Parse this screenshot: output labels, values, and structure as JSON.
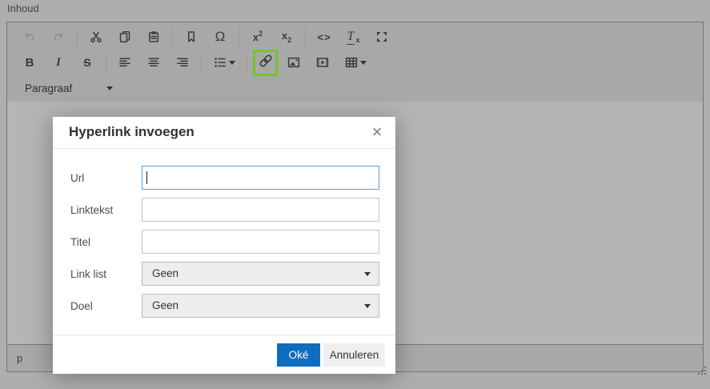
{
  "page": {
    "content_label": "Inhoud"
  },
  "toolbar": {
    "glyphs": {
      "bold": "B",
      "italic": "I",
      "strikethrough": "S",
      "charmap": "Ω",
      "sup_base": "x",
      "sup_mark": "2",
      "sub_base": "x",
      "sub_mark": "2",
      "code": "<>",
      "removeformat_base": "T",
      "removeformat_mark": "x"
    },
    "format_select": {
      "value": "Paragraaf"
    },
    "highlight_color": "#74c32e"
  },
  "statusbar": {
    "element_path": "p"
  },
  "dialog": {
    "title": "Hyperlink invoegen",
    "close": "×",
    "fields": {
      "url": {
        "label": "Url",
        "value": "",
        "focused": true
      },
      "linktekst": {
        "label": "Linktekst",
        "value": ""
      },
      "titel": {
        "label": "Titel",
        "value": ""
      },
      "link_list": {
        "label": "Link list",
        "value": "Geen"
      },
      "doel": {
        "label": "Doel",
        "value": "Geen"
      }
    },
    "buttons": {
      "ok": {
        "label": "Oké"
      },
      "cancel": {
        "label": "Annuleren"
      }
    },
    "colors": {
      "primary_button": "#0f6dbf",
      "focus_border": "#569ce4"
    }
  }
}
